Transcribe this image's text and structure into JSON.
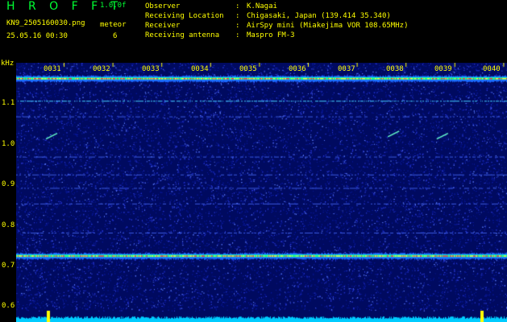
{
  "header": {
    "title": "H R O F F T",
    "version": "1.0.0f",
    "filename": "KN9_2505160030.png",
    "datetime": "25.05.16 00:30",
    "meteor_label": "meteor",
    "meteor_count": "6"
  },
  "info": [
    {
      "key": "Observer",
      "value": "K.Nagai"
    },
    {
      "key": "Receiving Location",
      "value": "Chigasaki, Japan (139.414 35.340)"
    },
    {
      "key": "Receiver",
      "value": "AirSpy mini (Miakejima VOR 108.65MHz)"
    },
    {
      "key": "Receiving antenna",
      "value": "Maspro FM-3"
    }
  ],
  "axis": {
    "unit": "kHz",
    "y_ticks": [
      "1.1",
      "1.0",
      "0.9",
      "0.8",
      "0.7",
      "0.6"
    ],
    "x_ticks": [
      "0031",
      "0032",
      "0033",
      "0034",
      "0035",
      "0036",
      "0037",
      "0038",
      "0039",
      "0040"
    ]
  },
  "colors": {
    "text_yellow": "#ffff00",
    "title_green": "#00ff33",
    "background_blue": "#000a60",
    "tick_color": "#ffff00",
    "baseline": "#00ccff"
  },
  "spectrogram": {
    "freq_range_khz": [
      0.58,
      1.16
    ],
    "carrier_lines_khz": [
      1.125,
      1.075,
      0.728
    ],
    "meteor_echoes": [
      {
        "time": "0031",
        "freq_khz": 0.995
      },
      {
        "time": "0038",
        "freq_khz": 1.0
      },
      {
        "time": "0039",
        "freq_khz": 0.995
      }
    ]
  }
}
